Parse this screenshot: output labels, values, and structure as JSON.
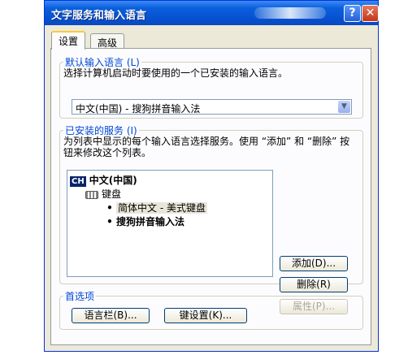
{
  "window": {
    "title": "文字服务和输入语言",
    "help_glyph": "?",
    "close_glyph": "✕"
  },
  "tabs": [
    {
      "label": "设置",
      "active": true
    },
    {
      "label": "高级",
      "active": false
    }
  ],
  "default_language": {
    "group_label": "默认输入语言 (L)",
    "description": "选择计算机启动时要使用的一个已安装的输入语言。",
    "selected": "中文(中国) - 搜狗拼音输入法"
  },
  "installed_services": {
    "group_label": "已安装的服务 (I)",
    "description": "为列表中显示的每个输入语言选择服务。使用 “添加” 和 “删除” 按钮来修改这个列表。",
    "language_code": "CH",
    "language": "中文(中国)",
    "category": "键盘",
    "items": [
      {
        "label": "简体中文 - 美式键盘",
        "selected": true
      },
      {
        "label": "搜狗拼音输入法",
        "bold": true
      }
    ],
    "buttons": {
      "add": "添加(D)...",
      "remove": "删除(R)",
      "properties": "属性(P)..."
    }
  },
  "preferences": {
    "group_label": "首选项",
    "language_bar": "语言栏(B)...",
    "key_settings": "键设置(K)..."
  }
}
